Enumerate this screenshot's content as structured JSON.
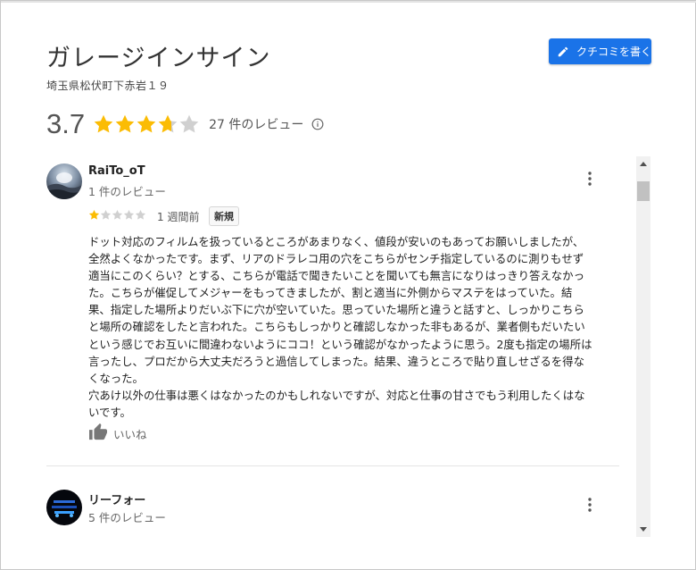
{
  "place": {
    "name": "ガレージインサイン",
    "address": "埼玉県松伏町下赤岩１９",
    "write_review_label": "クチコミを書く"
  },
  "rating": {
    "value": "3.7",
    "stars": 3.7,
    "review_count": "27 件のレビュー"
  },
  "reviews": [
    {
      "name": "RaiTo_oT",
      "meta": "1 件のレビュー",
      "stars": 1,
      "time": "1 週間前",
      "badge": "新規",
      "text_lines": [
        "ドット対応のフィルムを扱っているところがあまりなく、値段が安いのもあってお願いしましたが、",
        "全然よくなかったです。まず、リアのドラレコ用の穴をこちらがセンチ指定しているのに測りもせず",
        "適当にこのくらい？とする、こちらが電話で聞きたいことを聞いても無言になりはっきり答えなかっ",
        "た。こちらが催促してメジャーをもってきましたが、割と適当に外側からマステをはっていた。結",
        "果、指定した場所よりだいぶ下に穴が空いていた。思っていた場所と違うと話すと、しっかりこちら",
        "と場所の確認をしたと言われた。こちらもしっかりと確認しなかった非もあるが、業者側もだいたい",
        "という感じでお互いに間違わないようにココ！という確認がなかったように思う。2度も指定の場所は",
        "言ったし、プロだから大丈夫だろうと過信してしまった。結果、違うところで貼り直しせざるを得な",
        "くなった。",
        "穴あけ以外の仕事は悪くはなかったのかもしれないですが、対応と仕事の甘さでもう利用したくはな",
        "いです。"
      ],
      "like_label": "いいね"
    },
    {
      "name": "リーフォー",
      "meta": "5 件のレビュー"
    }
  ],
  "colors": {
    "accent": "#1a73e8",
    "star_filled": "#fbbc04",
    "star_empty": "#d0d0d0"
  }
}
